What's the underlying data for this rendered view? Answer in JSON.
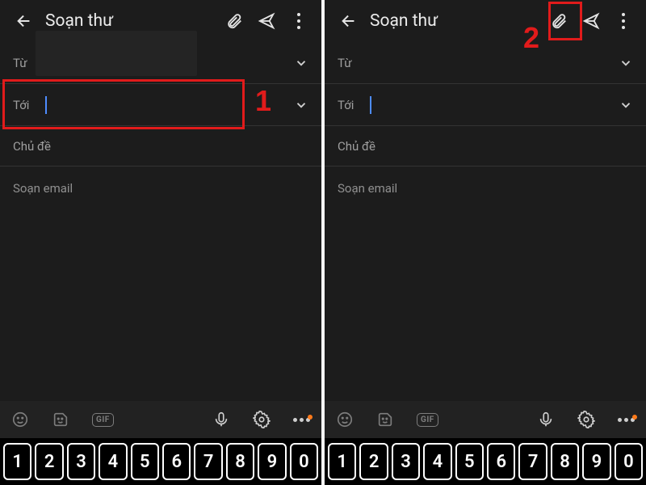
{
  "header": {
    "title": "Soạn thư"
  },
  "compose": {
    "from_label": "Từ",
    "to_label": "Tới",
    "subject_placeholder": "Chủ đề",
    "body_placeholder": "Soạn email"
  },
  "keyboard": {
    "gif_label": "GIF",
    "numbers": [
      "1",
      "2",
      "3",
      "4",
      "5",
      "6",
      "7",
      "8",
      "9",
      "0"
    ]
  },
  "annotations": {
    "step1": "1",
    "step2": "2"
  },
  "icons": {
    "back": "back-arrow",
    "attach": "paperclip",
    "send": "send-plane",
    "overflow": "more-vert",
    "chevron": "chevron-down",
    "emoji": "smiley",
    "sticker": "sticker",
    "mic": "microphone",
    "settings": "gear"
  }
}
